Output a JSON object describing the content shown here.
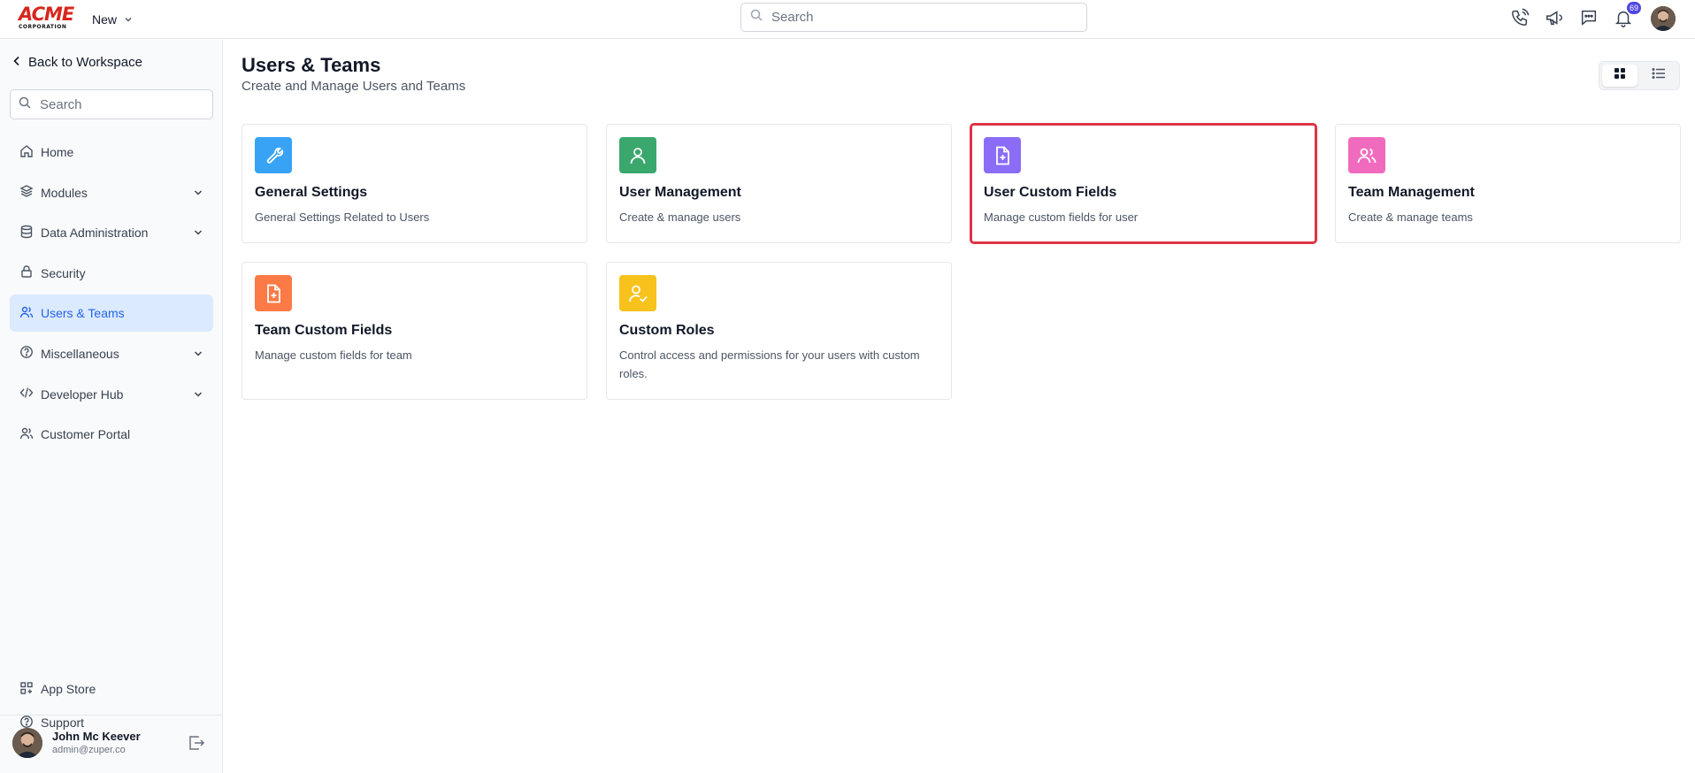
{
  "header": {
    "logo_main": "ACME",
    "logo_sub": "CORPORATION",
    "new_label": "New",
    "search_placeholder": "Search",
    "notification_count": "69",
    "icons": [
      "phone-icon",
      "megaphone-icon",
      "chat-icon",
      "bell-icon"
    ]
  },
  "sidebar": {
    "back_label": "Back to Workspace",
    "search_placeholder": "Search",
    "items": [
      {
        "label": "Home",
        "icon": "home-icon",
        "expandable": false,
        "active": false
      },
      {
        "label": "Modules",
        "icon": "layers-icon",
        "expandable": true,
        "active": false
      },
      {
        "label": "Data Administration",
        "icon": "database-icon",
        "expandable": true,
        "active": false
      },
      {
        "label": "Security",
        "icon": "lock-icon",
        "expandable": false,
        "active": false
      },
      {
        "label": "Users & Teams",
        "icon": "users-icon",
        "expandable": false,
        "active": true
      },
      {
        "label": "Miscellaneous",
        "icon": "help-circle-icon",
        "expandable": true,
        "active": false
      },
      {
        "label": "Developer Hub",
        "icon": "code-icon",
        "expandable": true,
        "active": false
      },
      {
        "label": "Customer Portal",
        "icon": "users-icon",
        "expandable": false,
        "active": false
      }
    ],
    "bottom_items": [
      {
        "label": "App Store",
        "icon": "apps-icon"
      },
      {
        "label": "Support",
        "icon": "help-circle-icon"
      }
    ],
    "user": {
      "name": "John Mc Keever",
      "email": "admin@zuper.co"
    }
  },
  "main": {
    "title": "Users & Teams",
    "subtitle": "Create and Manage Users and Teams",
    "view_mode": "grid",
    "cards": [
      {
        "title": "General Settings",
        "description": "General Settings Related to Users",
        "icon": "wrench-icon",
        "color": "#38a3f5"
      },
      {
        "title": "User Management",
        "description": "Create & manage users",
        "icon": "user-icon",
        "color": "#3aa76d"
      },
      {
        "title": "User Custom Fields",
        "description": "Manage custom fields for user",
        "icon": "file-plus-icon",
        "color": "#8b6cf6",
        "highlighted": true
      },
      {
        "title": "Team Management",
        "description": "Create & manage teams",
        "icon": "users-icon",
        "color": "#f06bbd"
      },
      {
        "title": "Team Custom Fields",
        "description": "Manage custom fields for team",
        "icon": "file-plus-icon",
        "color": "#fb7a45"
      },
      {
        "title": "Custom Roles",
        "description": "Control access and permissions for your users with custom roles.",
        "icon": "user-check-icon",
        "color": "#f8c21c"
      }
    ]
  }
}
